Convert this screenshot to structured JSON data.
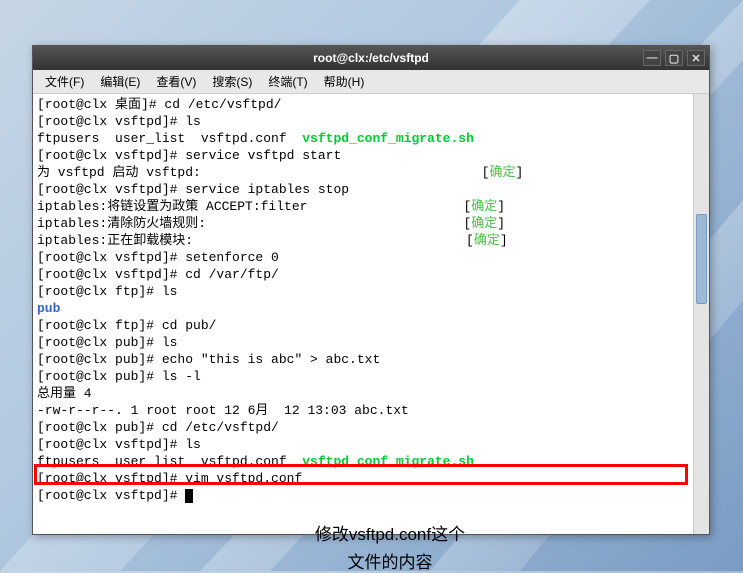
{
  "window": {
    "title": "root@clx:/etc/vsftpd",
    "controls": {
      "minimize": "—",
      "maximize": "▢",
      "close": "✕"
    }
  },
  "menubar": [
    "文件(F)",
    "编辑(E)",
    "查看(V)",
    "搜索(S)",
    "终端(T)",
    "帮助(H)"
  ],
  "terminal": {
    "lines": [
      {
        "segs": [
          {
            "t": "[root@clx 桌面]# cd /etc/vsftpd/"
          }
        ]
      },
      {
        "segs": [
          {
            "t": "[root@clx vsftpd]# ls"
          }
        ]
      },
      {
        "segs": [
          {
            "t": "ftpusers  user_list  vsftpd.conf  "
          },
          {
            "t": "vsftpd_conf_migrate.sh",
            "c": "bgreen"
          }
        ]
      },
      {
        "segs": [
          {
            "t": "[root@clx vsftpd]# service vsftpd start"
          }
        ]
      },
      {
        "segs": [
          {
            "t": "为 vsftpd 启动 vsftpd:                                    ["
          },
          {
            "t": "确定",
            "c": "green"
          },
          {
            "t": "]"
          }
        ]
      },
      {
        "segs": [
          {
            "t": "[root@clx vsftpd]# service iptables stop"
          }
        ]
      },
      {
        "segs": [
          {
            "t": "iptables:将链设置为政策 ACCEPT:filter                    ["
          },
          {
            "t": "确定",
            "c": "green"
          },
          {
            "t": "]"
          }
        ]
      },
      {
        "segs": [
          {
            "t": "iptables:清除防火墙规则:                                 ["
          },
          {
            "t": "确定",
            "c": "green"
          },
          {
            "t": "]"
          }
        ]
      },
      {
        "segs": [
          {
            "t": "iptables:正在卸载模块:                                   ["
          },
          {
            "t": "确定",
            "c": "green"
          },
          {
            "t": "]"
          }
        ]
      },
      {
        "segs": [
          {
            "t": "[root@clx vsftpd]# setenforce 0"
          }
        ]
      },
      {
        "segs": [
          {
            "t": "[root@clx vsftpd]# cd /var/ftp/"
          }
        ]
      },
      {
        "segs": [
          {
            "t": "[root@clx ftp]# ls"
          }
        ]
      },
      {
        "segs": [
          {
            "t": "pub",
            "c": "blue"
          }
        ]
      },
      {
        "segs": [
          {
            "t": "[root@clx ftp]# cd pub/"
          }
        ]
      },
      {
        "segs": [
          {
            "t": "[root@clx pub]# ls"
          }
        ]
      },
      {
        "segs": [
          {
            "t": "[root@clx pub]# echo \"this is abc\" > abc.txt"
          }
        ]
      },
      {
        "segs": [
          {
            "t": "[root@clx pub]# ls -l"
          }
        ]
      },
      {
        "segs": [
          {
            "t": "总用量 4"
          }
        ]
      },
      {
        "segs": [
          {
            "t": "-rw-r--r--. 1 root root 12 6月  12 13:03 abc.txt"
          }
        ]
      },
      {
        "segs": [
          {
            "t": "[root@clx pub]# cd /etc/vsftpd/"
          }
        ]
      },
      {
        "segs": [
          {
            "t": "[root@clx vsftpd]# ls"
          }
        ]
      },
      {
        "segs": [
          {
            "t": "ftpusers  user_list  vsftpd.conf  "
          },
          {
            "t": "vsftpd_conf_migrate.sh",
            "c": "bgreen"
          }
        ]
      },
      {
        "segs": [
          {
            "t": "[root@clx vsftpd]# vim vsftpd.conf"
          }
        ]
      },
      {
        "segs": [
          {
            "t": "[root@clx vsftpd]# "
          }
        ],
        "cursor": true
      }
    ]
  },
  "caption": {
    "line1": "修改vsftpd.conf这个",
    "line2": "文件的内容"
  }
}
